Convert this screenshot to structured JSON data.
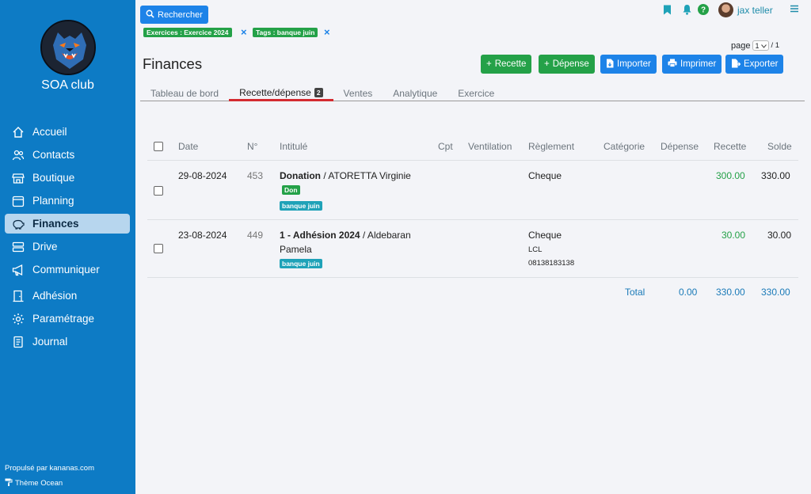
{
  "sidebar": {
    "club_name": "SOA club",
    "items": [
      {
        "label": "Accueil",
        "icon": "home-icon"
      },
      {
        "label": "Contacts",
        "icon": "users-icon"
      },
      {
        "label": "Boutique",
        "icon": "shop-icon"
      },
      {
        "label": "Planning",
        "icon": "calendar-icon"
      },
      {
        "label": "Finances",
        "icon": "piggy-bank-icon",
        "active": true
      },
      {
        "label": "Drive",
        "icon": "drive-icon"
      },
      {
        "label": "Communiquer",
        "icon": "megaphone-icon"
      },
      {
        "label": "Adhésion",
        "icon": "door-icon"
      },
      {
        "label": "Paramétrage",
        "icon": "gear-icon"
      },
      {
        "label": "Journal",
        "icon": "journal-icon"
      }
    ],
    "footer_powered": "Propulsé par kananas.com",
    "footer_theme": "Thème Ocean"
  },
  "header": {
    "search_label": "Rechercher",
    "filters": [
      "Exercices : Exercice 2024",
      "Tags : banque juin"
    ],
    "user_name": "jax teller",
    "page_label": "page",
    "page_current": "1",
    "page_total": "/ 1"
  },
  "page": {
    "title": "Finances",
    "actions": [
      "Recette",
      "Dépense",
      "Importer",
      "Imprimer",
      "Exporter"
    ]
  },
  "tabs": [
    {
      "label": "Tableau de bord"
    },
    {
      "label": "Recette/dépense",
      "badge": "2",
      "active": true
    },
    {
      "label": "Ventes"
    },
    {
      "label": "Analytique"
    },
    {
      "label": "Exercice"
    }
  ],
  "table": {
    "headers": [
      "Date",
      "N°",
      "Intitulé",
      "Cpt",
      "Ventilation",
      "Règlement",
      "Catégorie",
      "Dépense",
      "Recette",
      "Solde"
    ],
    "rows": [
      {
        "date": "29-08-2024",
        "num": "453",
        "title_bold": "Donation",
        "title_rest": " / ATORETTA Virginie",
        "tags": [
          "Don",
          "banque juin"
        ],
        "reglement": "Cheque",
        "recette": "300.00",
        "solde": "330.00"
      },
      {
        "date": "23-08-2024",
        "num": "449",
        "title_bold": "1 - Adhésion 2024",
        "title_rest": " / Aldebaran",
        "title_line2": "Pamela",
        "tags": [
          "banque juin"
        ],
        "reglement": "Cheque",
        "bank": "LCL",
        "cheque_no": "08138183138",
        "recette": "30.00",
        "solde": "30.00"
      }
    ],
    "total_label": "Total",
    "total_depense": "0.00",
    "total_recette": "330.00",
    "total_solde": "330.00"
  }
}
